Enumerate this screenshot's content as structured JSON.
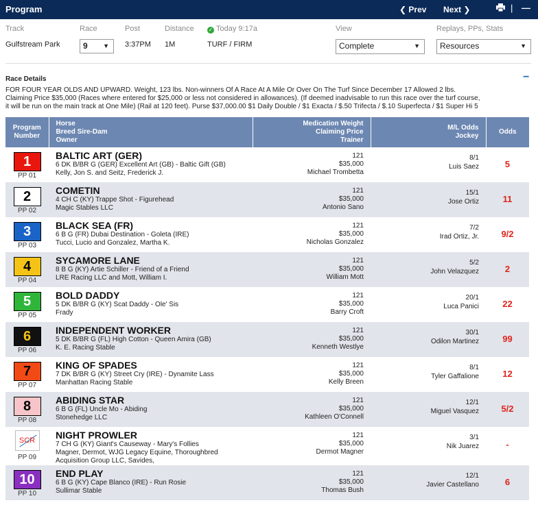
{
  "header": {
    "title": "Program",
    "prev_label": "Prev",
    "next_label": "Next",
    "print_icon": "print-icon",
    "separator": "|",
    "collapse": "—"
  },
  "info": {
    "track_label": "Track",
    "track_value": "Gulfstream Park",
    "race_label": "Race",
    "race_value": "9",
    "post_label": "Post",
    "post_value": "3:37PM",
    "distance_label": "Distance",
    "distance_value": "1M",
    "today_label": "Today 9:17a",
    "surface_value": "TURF / FIRM",
    "view_label": "View",
    "view_value": "Complete",
    "replays_label": "Replays, PPs, Stats",
    "replays_value": "Resources"
  },
  "race_details": {
    "title": "Race Details",
    "toggle": "−",
    "line1": "FOR FOUR YEAR OLDS AND UPWARD. Weight, 123 lbs. Non-winners Of A Race At A Mile Or Over On The Turf Since December 17 Allowed 2 lbs.",
    "line2": "Claiming Price $35,000 (Races where entered for $25,000 or less not considered in allowances). (If deemed inadvisable to run this race over the turf course,",
    "line3": "it will be run on the main track at One Mile) (Rail at 120 feet). Purse $37,000.00 $1 Daily Double / $1 Exacta / $.50 Trifecta / $.10 Superfecta / $1 Super Hi 5"
  },
  "table": {
    "headers": {
      "program_number": "Program\nNumber",
      "horse": "Horse\nBreed Sire-Dam\nOwner",
      "medication": "Medication Weight\nClaiming Price\nTrainer",
      "ml_odds": "M/L Odds\nJockey",
      "odds": "Odds"
    },
    "rows": [
      {
        "num": "1",
        "bg": "#e8160d",
        "fg": "#ffffff",
        "pp": "PP 01",
        "name": "BALTIC ART (GER)",
        "breed": "6 DK B/BR G (GER) Excellent Art (GB) - Baltic Gift (GB)",
        "owner": "Kelly, Jon S. and Seitz, Frederick J.",
        "weight": "121",
        "price": "$35,000",
        "trainer": "Michael Trombetta",
        "ml": "8/1",
        "jockey": "Luis Saez",
        "odds": "5"
      },
      {
        "num": "2",
        "bg": "#ffffff",
        "fg": "#000000",
        "pp": "PP 02",
        "name": "COMETIN",
        "breed": "4 CH C (KY) Trappe Shot - Figurehead",
        "owner": "Magic Stables LLC",
        "weight": "121",
        "price": "$35,000",
        "trainer": "Antonio Sano",
        "ml": "15/1",
        "jockey": "Jose Ortiz",
        "odds": "11"
      },
      {
        "num": "3",
        "bg": "#1a63c7",
        "fg": "#ffffff",
        "pp": "PP 03",
        "name": "BLACK SEA (FR)",
        "breed": "6 B G (FR) Dubai Destination - Goleta (IRE)",
        "owner": "Tucci, Lucio and Gonzalez, Martha K.",
        "weight": "121",
        "price": "$35,000",
        "trainer": "Nicholas Gonzalez",
        "ml": "7/2",
        "jockey": "Irad Ortiz, Jr.",
        "odds": "9/2"
      },
      {
        "num": "4",
        "bg": "#f5c316",
        "fg": "#000000",
        "pp": "PP 04",
        "name": "SYCAMORE LANE",
        "breed": "8 B G (KY) Artie Schiller - Friend of a Friend",
        "owner": "LRE Racing LLC and Mott, William I.",
        "weight": "121",
        "price": "$35,000",
        "trainer": "William Mott",
        "ml": "5/2",
        "jockey": "John Velazquez",
        "odds": "2"
      },
      {
        "num": "5",
        "bg": "#2fb53a",
        "fg": "#ffffff",
        "pp": "PP 05",
        "name": "BOLD DADDY",
        "breed": "5 DK B/BR G (KY) Scat Daddy - Ole' Sis",
        "owner": "Frady",
        "weight": "121",
        "price": "$35,000",
        "trainer": "Barry Croft",
        "ml": "20/1",
        "jockey": "Luca Panici",
        "odds": "22"
      },
      {
        "num": "6",
        "bg": "#111111",
        "fg": "#f5c316",
        "pp": "PP 06",
        "name": "INDEPENDENT WORKER",
        "breed": "5 DK B/BR G (FL) High Cotton - Queen Amira (GB)",
        "owner": "K. E. Racing Stable",
        "weight": "121",
        "price": "$35,000",
        "trainer": "Kenneth Westlye",
        "ml": "30/1",
        "jockey": "Odilon Martinez",
        "odds": "99"
      },
      {
        "num": "7",
        "bg": "#f24a15",
        "fg": "#000000",
        "pp": "PP 07",
        "name": "KING OF SPADES",
        "breed": "7 DK B/BR G (KY) Street Cry (IRE) - Dynamite Lass",
        "owner": "Manhattan Racing Stable",
        "weight": "121",
        "price": "$35,000",
        "trainer": "Kelly Breen",
        "ml": "8/1",
        "jockey": "Tyler Gaffalione",
        "odds": "12"
      },
      {
        "num": "8",
        "bg": "#f7c5c9",
        "fg": "#000000",
        "pp": "PP 08",
        "name": "ABIDING STAR",
        "breed": "6 B G (FL) Uncle Mo - Abiding",
        "owner": "Stonehedge LLC",
        "weight": "121",
        "price": "$35,000",
        "trainer": "Kathleen O'Connell",
        "ml": "12/1",
        "jockey": "Miguel Vasquez",
        "odds": "5/2"
      },
      {
        "num": "SCR",
        "bg": "#ffffff",
        "fg": "#e0241c",
        "pp": "PP 09",
        "name": "NIGHT PROWLER",
        "breed": "7 CH G (KY) Giant's Causeway - Mary's Follies",
        "owner": "Magner, Dermot, WJG Legacy Equine, Thoroughbred",
        "owner2": "Acquisition Group LLC, Savides,",
        "weight": "121",
        "price": "$35,000",
        "trainer": "Dermot Magner",
        "ml": "3/1",
        "jockey": "Nik Juarez",
        "odds": "-",
        "scratched": true
      },
      {
        "num": "10",
        "bg": "#8a2fc0",
        "fg": "#ffffff",
        "pp": "PP 10",
        "name": "END PLAY",
        "breed": "6 B G (KY) Cape Blanco (IRE) - Run Rosie",
        "owner": "Sullimar Stable",
        "weight": "121",
        "price": "$35,000",
        "trainer": "Thomas Bush",
        "ml": "12/1",
        "jockey": "Javier Castellano",
        "odds": "6"
      }
    ]
  },
  "colors": {
    "topbar": "#0b2a57",
    "table_header": "#6c87b1",
    "alt_row": "#e1e4ea",
    "odds": "#e0241c"
  }
}
